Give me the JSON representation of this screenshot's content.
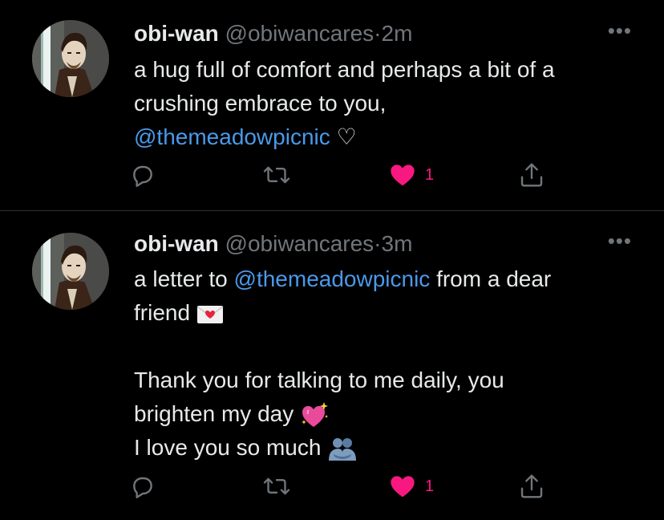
{
  "tweets": [
    {
      "name": "obi-wan",
      "handle": "@obiwancares",
      "separator": "·",
      "time": "2m",
      "more": "•••",
      "text_line1": "a hug full of comfort and perhaps a bit of a",
      "text_line2": "crushing embrace to you,",
      "mention": "@themeadowpicnic",
      "heart_symbol": "♡",
      "like_count": "1"
    },
    {
      "name": "obi-wan",
      "handle": "@obiwancares",
      "separator": "·",
      "time": "3m",
      "more": "•••",
      "text_prefix": "a letter to ",
      "mention": "@themeadowpicnic",
      "text_suffix": " from a dear",
      "text_line2": "friend",
      "text_line3": "Thank you for talking to me daily, you",
      "text_line4": "brighten my day",
      "text_line5": "I love you so much",
      "like_count": "1"
    }
  ],
  "colors": {
    "background": "#000000",
    "text": "#e7e9ea",
    "secondary": "#71767b",
    "link": "#4a99e9",
    "like": "#f91880"
  },
  "icons": {
    "reply": "reply-icon",
    "retweet": "retweet-icon",
    "like": "heart-filled-icon",
    "share": "share-icon",
    "more": "more-icon",
    "letter_emoji": "love-letter-emoji",
    "sparkle_heart_emoji": "sparkling-heart-emoji",
    "hug_emoji": "people-hugging-emoji"
  }
}
